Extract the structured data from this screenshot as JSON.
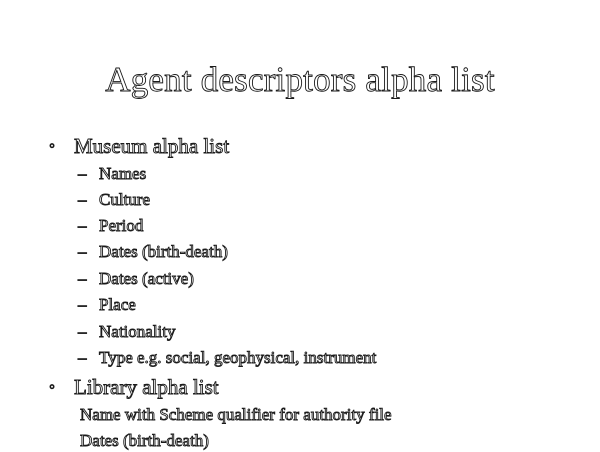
{
  "slide": {
    "title": "Agent descriptors alpha list",
    "sections": [
      {
        "bullet": "◦",
        "heading": "Museum alpha list",
        "items": [
          "Names",
          "Culture",
          "Period",
          "Dates (birth-death)",
          "Dates (active)",
          "Place",
          "Nationality",
          "Type e.g. social, geophysical, instrument"
        ]
      },
      {
        "bullet": "◦",
        "heading": "Library alpha list",
        "lines": [
          "Name with Scheme qualifier for authority file",
          "Dates (birth-death)"
        ]
      }
    ],
    "dash_glyph": "–"
  }
}
